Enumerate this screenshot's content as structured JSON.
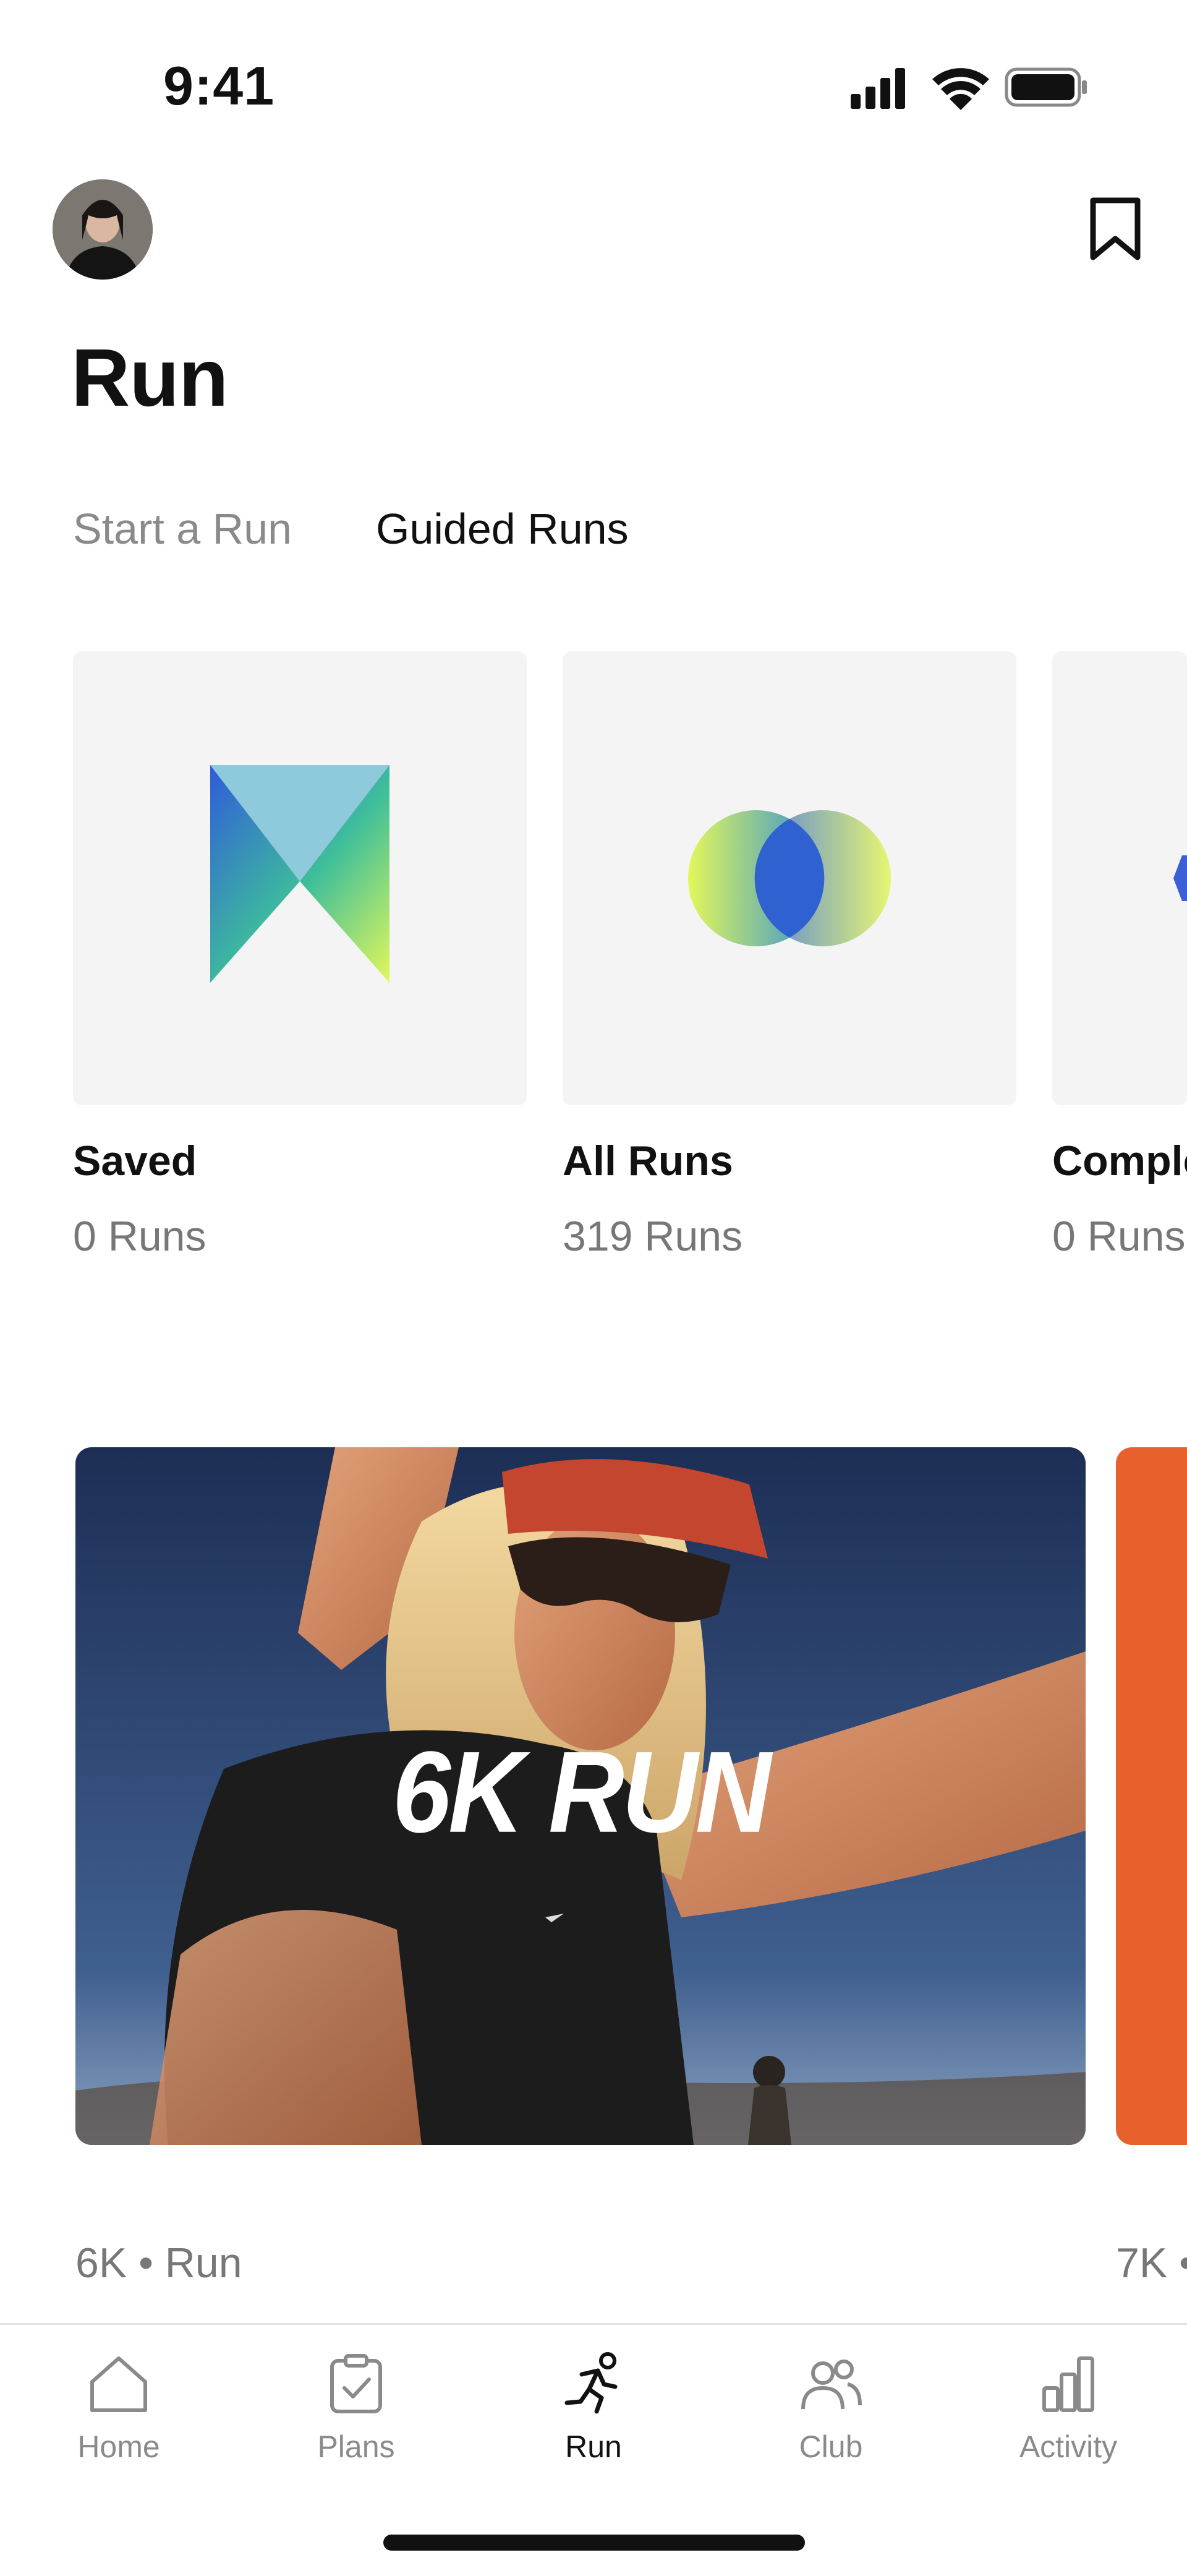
{
  "status_bar": {
    "time": "9:41",
    "icons": [
      "signal-icon",
      "wifi-icon",
      "battery-icon"
    ]
  },
  "header": {
    "title": "Run",
    "bookmark_icon": "bookmark-icon"
  },
  "tabs": [
    {
      "label": "Start a Run",
      "active": false
    },
    {
      "label": "Guided Runs",
      "active": true
    }
  ],
  "collections": [
    {
      "title": "Saved",
      "count": "0 Runs",
      "icon": "saved-gradient-icon"
    },
    {
      "title": "All Runs",
      "count": "319 Runs",
      "icon": "all-runs-gradient-icon"
    },
    {
      "title": "Comple",
      "count": "0 Runs",
      "icon": "completed-gradient-icon"
    }
  ],
  "featured": [
    {
      "title": "6K RUN",
      "meta": "6K • Run"
    },
    {
      "meta": "7K •"
    }
  ],
  "nav": {
    "items": [
      {
        "label": "Home",
        "icon": "home-icon",
        "active": false
      },
      {
        "label": "Plans",
        "icon": "plans-icon",
        "active": false
      },
      {
        "label": "Run",
        "icon": "run-icon",
        "active": true
      },
      {
        "label": "Club",
        "icon": "club-icon",
        "active": false
      },
      {
        "label": "Activity",
        "icon": "activity-icon",
        "active": false
      }
    ]
  },
  "colors": {
    "accent_next_card": "#e8612c",
    "muted_text": "#777777",
    "tile_bg": "#f4f4f4"
  }
}
